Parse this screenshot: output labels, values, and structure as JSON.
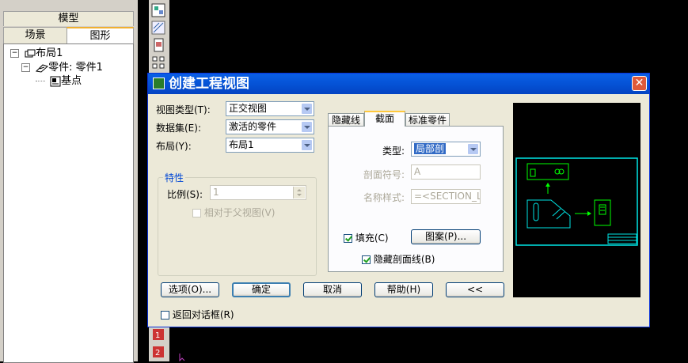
{
  "left_panel": {
    "model_tab": "模型",
    "subtabs": [
      {
        "label": "场景"
      },
      {
        "label": "图形"
      }
    ],
    "tree": [
      {
        "label": "布局1",
        "icon": "layout-icon"
      },
      {
        "label": "零件: 零件1",
        "icon": "part-icon"
      },
      {
        "label": "基点",
        "icon": "base-point-icon"
      }
    ]
  },
  "dialog": {
    "title": "创建工程视图",
    "close": "✕",
    "view_type": {
      "label": "视图类型(T):",
      "value": "正交视图"
    },
    "dataset": {
      "label": "数据集(E):",
      "value": "激活的零件"
    },
    "layout": {
      "label": "布局(Y):",
      "value": "布局1"
    },
    "properties": {
      "title": "特性",
      "scale_label": "比例(S):",
      "scale_value": "1",
      "relative_label": "相对于父视图(V)"
    },
    "tabs": [
      {
        "label": "隐藏线"
      },
      {
        "label": "截面"
      },
      {
        "label": "标准零件"
      }
    ],
    "section": {
      "type_label": "类型:",
      "type_value": "局部剖",
      "symbol_label": "剖面符号:",
      "symbol_value": "A",
      "name_style_label": "名称样式:",
      "name_style_value": "=<SECTION_LA",
      "fill_label": "填充(C)",
      "pattern_button": "图案(P)...",
      "hide_lines_label": "隐藏剖面线(B)"
    },
    "buttons": {
      "options": "选项(O)...",
      "ok": "确定",
      "cancel": "取消",
      "help": "帮助(H)",
      "collapse": "<<"
    },
    "return_label": "返回对话框(R)"
  },
  "colors": {
    "preview_border": "#00e5e5",
    "preview_green": "#00ff00",
    "title_blue": "#0553d6"
  }
}
